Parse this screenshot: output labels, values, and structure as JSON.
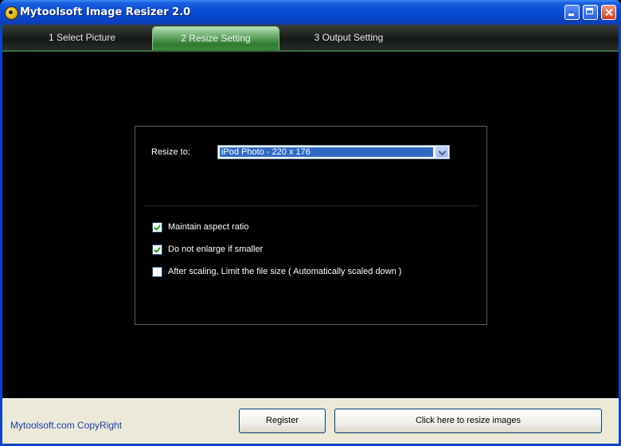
{
  "window": {
    "title": "Mytoolsoft Image Resizer 2.0"
  },
  "tabs": [
    {
      "label": "1 Select Picture"
    },
    {
      "label": "2 Resize Setting"
    },
    {
      "label": "3 Output Setting"
    }
  ],
  "resize": {
    "label": "Resize to:",
    "selected": "iPod Photo - 220 x 176"
  },
  "options": [
    {
      "label": "Maintain aspect ratio",
      "checked": true
    },
    {
      "label": "Do not enlarge if smaller",
      "checked": true
    },
    {
      "label": "After scaling, Limit the file size ( Automatically scaled down )",
      "checked": false
    }
  ],
  "footer": {
    "copyright": "Mytoolsoft.com CopyRight",
    "register_label": "Register",
    "resize_label": "Click here to resize images"
  },
  "icons": {
    "app": "app-icon",
    "minimize": "minimize-icon",
    "maximize": "maximize-icon",
    "close": "close-icon"
  }
}
